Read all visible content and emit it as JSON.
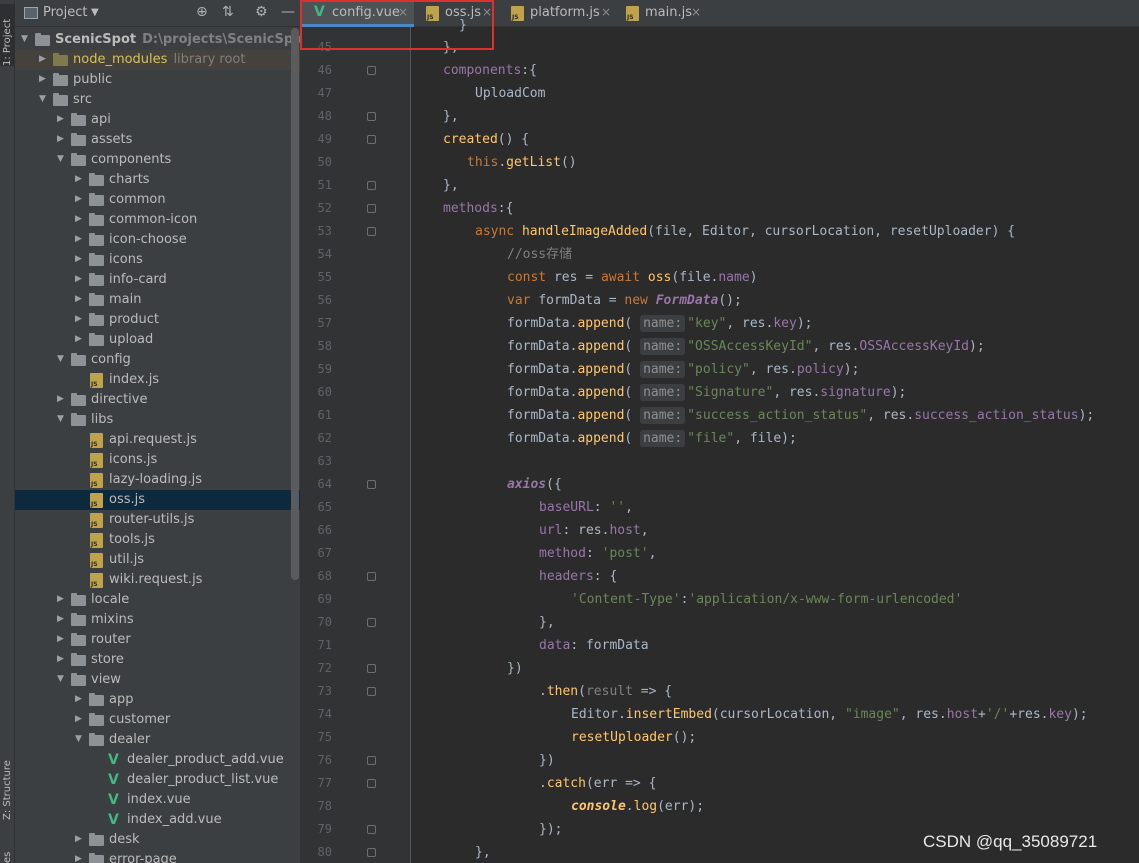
{
  "tool_strip": {
    "project_tab": "1: Project",
    "structure_tab": "Z: Structure",
    "other_tab": "es"
  },
  "project_panel": {
    "title": "Project",
    "icons": [
      "target-icon",
      "collapse-icon",
      "gear-icon",
      "minimize-icon"
    ],
    "tree": [
      {
        "label": "ScenicSpot",
        "sub": "D:\\projects\\ScenicSpot",
        "type": "folder",
        "depth": 0,
        "expanded": true,
        "bold": true
      },
      {
        "label": "node_modules",
        "sub": "library root",
        "type": "folder-lib",
        "depth": 1,
        "expanded": false
      },
      {
        "label": "public",
        "type": "folder",
        "depth": 1,
        "expanded": false
      },
      {
        "label": "src",
        "type": "folder",
        "depth": 1,
        "expanded": true
      },
      {
        "label": "api",
        "type": "folder",
        "depth": 2,
        "expanded": false
      },
      {
        "label": "assets",
        "type": "folder",
        "depth": 2,
        "expanded": false
      },
      {
        "label": "components",
        "type": "folder",
        "depth": 2,
        "expanded": true
      },
      {
        "label": "charts",
        "type": "folder",
        "depth": 3,
        "expanded": false
      },
      {
        "label": "common",
        "type": "folder",
        "depth": 3,
        "expanded": false
      },
      {
        "label": "common-icon",
        "type": "folder",
        "depth": 3,
        "expanded": false
      },
      {
        "label": "icon-choose",
        "type": "folder",
        "depth": 3,
        "expanded": false
      },
      {
        "label": "icons",
        "type": "folder",
        "depth": 3,
        "expanded": false
      },
      {
        "label": "info-card",
        "type": "folder",
        "depth": 3,
        "expanded": false
      },
      {
        "label": "main",
        "type": "folder",
        "depth": 3,
        "expanded": false
      },
      {
        "label": "product",
        "type": "folder",
        "depth": 3,
        "expanded": false
      },
      {
        "label": "upload",
        "type": "folder",
        "depth": 3,
        "expanded": false
      },
      {
        "label": "config",
        "type": "folder",
        "depth": 2,
        "expanded": true
      },
      {
        "label": "index.js",
        "type": "js",
        "depth": 3
      },
      {
        "label": "directive",
        "type": "folder",
        "depth": 2,
        "expanded": false
      },
      {
        "label": "libs",
        "type": "folder",
        "depth": 2,
        "expanded": true
      },
      {
        "label": "api.request.js",
        "type": "js",
        "depth": 3
      },
      {
        "label": "icons.js",
        "type": "js",
        "depth": 3
      },
      {
        "label": "lazy-loading.js",
        "type": "js",
        "depth": 3
      },
      {
        "label": "oss.js",
        "type": "js",
        "depth": 3,
        "selected": true
      },
      {
        "label": "router-utils.js",
        "type": "js",
        "depth": 3
      },
      {
        "label": "tools.js",
        "type": "js",
        "depth": 3
      },
      {
        "label": "util.js",
        "type": "js",
        "depth": 3
      },
      {
        "label": "wiki.request.js",
        "type": "js",
        "depth": 3
      },
      {
        "label": "locale",
        "type": "folder",
        "depth": 2,
        "expanded": false
      },
      {
        "label": "mixins",
        "type": "folder",
        "depth": 2,
        "expanded": false
      },
      {
        "label": "router",
        "type": "folder",
        "depth": 2,
        "expanded": false
      },
      {
        "label": "store",
        "type": "folder",
        "depth": 2,
        "expanded": false
      },
      {
        "label": "view",
        "type": "folder",
        "depth": 2,
        "expanded": true
      },
      {
        "label": "app",
        "type": "folder",
        "depth": 3,
        "expanded": false
      },
      {
        "label": "customer",
        "type": "folder",
        "depth": 3,
        "expanded": false
      },
      {
        "label": "dealer",
        "type": "folder",
        "depth": 3,
        "expanded": true
      },
      {
        "label": "dealer_product_add.vue",
        "type": "vue",
        "depth": 4
      },
      {
        "label": "dealer_product_list.vue",
        "type": "vue",
        "depth": 4
      },
      {
        "label": "index.vue",
        "type": "vue",
        "depth": 4
      },
      {
        "label": "index_add.vue",
        "type": "vue",
        "depth": 4
      },
      {
        "label": "desk",
        "type": "folder",
        "depth": 3,
        "expanded": false
      },
      {
        "label": "error-page",
        "type": "folder",
        "depth": 3,
        "expanded": false
      }
    ]
  },
  "tabs": [
    {
      "label": "config.vue",
      "icon": "vue-icon",
      "active": true
    },
    {
      "label": "oss.js",
      "icon": "js-icon",
      "active": false
    },
    {
      "label": "platform.js",
      "icon": "js-icon",
      "active": false
    },
    {
      "label": "main.js",
      "icon": "js-icon",
      "active": false
    }
  ],
  "tab_close_glyph": "×",
  "editor": {
    "first_line_partial": "}",
    "lines": [
      {
        "n": "45",
        "indent": 3,
        "tokens": [
          [
            "p",
            "},"
          ]
        ]
      },
      {
        "n": "46",
        "indent": 3,
        "tokens": [
          [
            "prop",
            "components"
          ],
          [
            "p",
            ":{"
          ]
        ]
      },
      {
        "n": "47",
        "indent": 4,
        "tokens": [
          [
            "p",
            "UploadCom"
          ]
        ]
      },
      {
        "n": "48",
        "indent": 3,
        "tokens": [
          [
            "p",
            "},"
          ]
        ]
      },
      {
        "n": "49",
        "indent": 3,
        "tokens": [
          [
            "fn",
            "created"
          ],
          [
            "p",
            "() {"
          ]
        ]
      },
      {
        "n": "50",
        "indent": 3.75,
        "tokens": [
          [
            "kw",
            "this"
          ],
          [
            "p",
            "."
          ],
          [
            "fn",
            "getList"
          ],
          [
            "p",
            "()"
          ]
        ]
      },
      {
        "n": "51",
        "indent": 3,
        "tokens": [
          [
            "p",
            "},"
          ]
        ]
      },
      {
        "n": "52",
        "indent": 3,
        "tokens": [
          [
            "prop",
            "methods"
          ],
          [
            "p",
            ":{"
          ]
        ]
      },
      {
        "n": "53",
        "indent": 4,
        "tokens": [
          [
            "kw",
            "async "
          ],
          [
            "fn",
            "handleImageAdded"
          ],
          [
            "p",
            "(file, Editor, cursorLocation, resetUploader) {"
          ]
        ]
      },
      {
        "n": "54",
        "indent": 5,
        "tokens": [
          [
            "cm",
            "//oss存储"
          ]
        ]
      },
      {
        "n": "55",
        "indent": 5,
        "tokens": [
          [
            "kw",
            "const "
          ],
          [
            "p",
            "res = "
          ],
          [
            "kw",
            "await "
          ],
          [
            "fn",
            "oss"
          ],
          [
            "p",
            "(file."
          ],
          [
            "prop",
            "name"
          ],
          [
            "p",
            ")"
          ]
        ]
      },
      {
        "n": "56",
        "indent": 5,
        "tokens": [
          [
            "kw",
            "var "
          ],
          [
            "p",
            "formData = "
          ],
          [
            "kw",
            "new "
          ],
          [
            "cls",
            "FormData"
          ],
          [
            "p",
            "();"
          ]
        ]
      },
      {
        "n": "57",
        "indent": 5,
        "tokens": [
          [
            "p",
            "formData."
          ],
          [
            "fn",
            "append"
          ],
          [
            "p",
            "( "
          ],
          [
            "hint",
            "name:"
          ],
          [
            "str",
            "\"key\""
          ],
          [
            "p",
            ", res."
          ],
          [
            "prop",
            "key"
          ],
          [
            "p",
            ");"
          ]
        ]
      },
      {
        "n": "58",
        "indent": 5,
        "tokens": [
          [
            "p",
            "formData."
          ],
          [
            "fn",
            "append"
          ],
          [
            "p",
            "( "
          ],
          [
            "hint",
            "name:"
          ],
          [
            "str",
            "\"OSSAccessKeyId\""
          ],
          [
            "p",
            ", res."
          ],
          [
            "prop",
            "OSSAccessKeyId"
          ],
          [
            "p",
            ");"
          ]
        ]
      },
      {
        "n": "59",
        "indent": 5,
        "tokens": [
          [
            "p",
            "formData."
          ],
          [
            "fn",
            "append"
          ],
          [
            "p",
            "( "
          ],
          [
            "hint",
            "name:"
          ],
          [
            "str",
            "\"policy\""
          ],
          [
            "p",
            ", res."
          ],
          [
            "prop",
            "policy"
          ],
          [
            "p",
            ");"
          ]
        ]
      },
      {
        "n": "60",
        "indent": 5,
        "tokens": [
          [
            "p",
            "formData."
          ],
          [
            "fn",
            "append"
          ],
          [
            "p",
            "( "
          ],
          [
            "hint",
            "name:"
          ],
          [
            "str",
            "\"Signature\""
          ],
          [
            "p",
            ", res."
          ],
          [
            "prop",
            "signature"
          ],
          [
            "p",
            ");"
          ]
        ]
      },
      {
        "n": "61",
        "indent": 5,
        "tokens": [
          [
            "p",
            "formData."
          ],
          [
            "fn",
            "append"
          ],
          [
            "p",
            "( "
          ],
          [
            "hint",
            "name:"
          ],
          [
            "str",
            "\"success_action_status\""
          ],
          [
            "p",
            ", res."
          ],
          [
            "prop",
            "success_action_status"
          ],
          [
            "p",
            ");"
          ]
        ]
      },
      {
        "n": "62",
        "indent": 5,
        "tokens": [
          [
            "p",
            "formData."
          ],
          [
            "fn",
            "append"
          ],
          [
            "p",
            "( "
          ],
          [
            "hint",
            "name:"
          ],
          [
            "str",
            "\"file\""
          ],
          [
            "p",
            ", file);"
          ]
        ]
      },
      {
        "n": "63",
        "indent": 5,
        "tokens": []
      },
      {
        "n": "64",
        "indent": 5,
        "tokens": [
          [
            "cls",
            "axios"
          ],
          [
            "p",
            "({"
          ]
        ]
      },
      {
        "n": "65",
        "indent": 6,
        "tokens": [
          [
            "prop",
            "baseURL"
          ],
          [
            "p",
            ": "
          ],
          [
            "str",
            "''"
          ],
          [
            "p",
            ","
          ]
        ]
      },
      {
        "n": "66",
        "indent": 6,
        "tokens": [
          [
            "prop",
            "url"
          ],
          [
            "p",
            ": res."
          ],
          [
            "prop",
            "host"
          ],
          [
            "p",
            ","
          ]
        ]
      },
      {
        "n": "67",
        "indent": 6,
        "tokens": [
          [
            "prop",
            "method"
          ],
          [
            "p",
            ": "
          ],
          [
            "str",
            "'post'"
          ],
          [
            "p",
            ","
          ]
        ]
      },
      {
        "n": "68",
        "indent": 6,
        "tokens": [
          [
            "prop",
            "headers"
          ],
          [
            "p",
            ": {"
          ]
        ]
      },
      {
        "n": "69",
        "indent": 7,
        "tokens": [
          [
            "str",
            "'Content-Type'"
          ],
          [
            "p",
            ":"
          ],
          [
            "str",
            "'application/x-www-form-urlencoded'"
          ]
        ]
      },
      {
        "n": "70",
        "indent": 6,
        "tokens": [
          [
            "p",
            "},"
          ]
        ]
      },
      {
        "n": "71",
        "indent": 6,
        "tokens": [
          [
            "prop",
            "data"
          ],
          [
            "p",
            ": formData"
          ]
        ]
      },
      {
        "n": "72",
        "indent": 5,
        "tokens": [
          [
            "p",
            "})"
          ]
        ]
      },
      {
        "n": "73",
        "indent": 6,
        "tokens": [
          [
            "p",
            "."
          ],
          [
            "fn",
            "then"
          ],
          [
            "p",
            "("
          ],
          [
            "cm",
            "result"
          ],
          [
            "p",
            " => {"
          ]
        ]
      },
      {
        "n": "74",
        "indent": 7,
        "tokens": [
          [
            "p",
            "Editor."
          ],
          [
            "fn",
            "insertEmbed"
          ],
          [
            "p",
            "(cursorLocation, "
          ],
          [
            "str",
            "\"image\""
          ],
          [
            "p",
            ", res."
          ],
          [
            "prop",
            "host"
          ],
          [
            "p",
            "+"
          ],
          [
            "str",
            "'/'"
          ],
          [
            "p",
            "+res."
          ],
          [
            "prop",
            "key"
          ],
          [
            "p",
            ");"
          ]
        ]
      },
      {
        "n": "75",
        "indent": 7,
        "tokens": [
          [
            "fn",
            "resetUploader"
          ],
          [
            "p",
            "();"
          ]
        ]
      },
      {
        "n": "76",
        "indent": 6,
        "tokens": [
          [
            "p",
            "})"
          ]
        ]
      },
      {
        "n": "77",
        "indent": 6,
        "tokens": [
          [
            "p",
            "."
          ],
          [
            "fn",
            "catch"
          ],
          [
            "p",
            "(err => {"
          ]
        ]
      },
      {
        "n": "78",
        "indent": 7,
        "tokens": [
          [
            "itf",
            "console"
          ],
          [
            "p",
            "."
          ],
          [
            "fn",
            "log"
          ],
          [
            "p",
            "(err);"
          ]
        ]
      },
      {
        "n": "79",
        "indent": 6,
        "tokens": [
          [
            "p",
            "});"
          ]
        ]
      },
      {
        "n": "80",
        "indent": 4,
        "tokens": [
          [
            "p",
            "},"
          ]
        ]
      }
    ]
  },
  "watermark": "CSDN @qq_35089721",
  "colors": {
    "keyword": "#cc7832",
    "string": "#6a8759",
    "property": "#9876aa",
    "function": "#ffc66d",
    "comment": "#808080",
    "highlight_box": "#e0302e",
    "active_tab_underline": "#4a88c7"
  }
}
